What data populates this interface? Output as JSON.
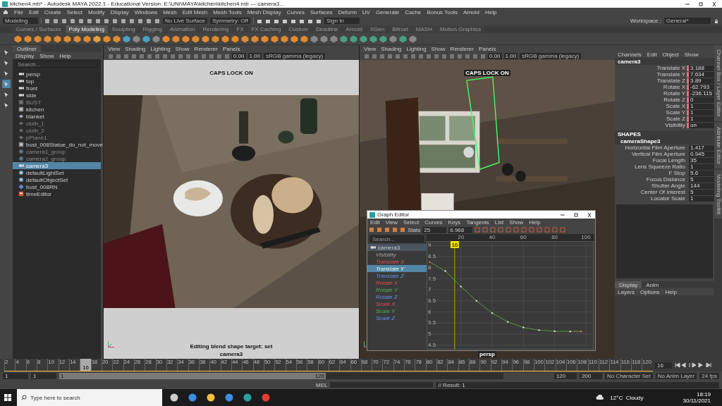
{
  "window": {
    "title": "kitchen4.mb* - Autodesk MAYA 2022.1 - Educational Version: E:\\UNI\\MAYA\\kitchen\\kitchen4.mb --- camera3..."
  },
  "menu_bar": [
    "File",
    "Edit",
    "Create",
    "Select",
    "Modify",
    "Display",
    "Windows",
    "Mesh",
    "Edit Mesh",
    "Mesh Tools",
    "Mesh Display",
    "Curves",
    "Surfaces",
    "Deform",
    "UV",
    "Generate",
    "Cache",
    "Bonus Tools",
    "Arnold",
    "Help"
  ],
  "status_line": {
    "menu_set": "Modeling",
    "live_surface": "No Live Surface",
    "symmetry": "Symmetry: Off",
    "sign_in": "Sign In",
    "workspace_label": "Workspace :",
    "workspace": "General*"
  },
  "shelf_tabs": [
    {
      "label": "Curves / Surfaces",
      "selected": false
    },
    {
      "label": "Poly Modeling",
      "selected": true
    },
    {
      "label": "Sculpting",
      "selected": false
    },
    {
      "label": "Rigging",
      "selected": false
    },
    {
      "label": "Animation",
      "selected": false
    },
    {
      "label": "Rendering",
      "selected": false
    },
    {
      "label": "FX",
      "selected": false
    },
    {
      "label": "FX Caching",
      "selected": false
    },
    {
      "label": "Custom",
      "selected": false
    },
    {
      "label": "Deadline",
      "selected": false
    },
    {
      "label": "Arnold",
      "selected": false
    },
    {
      "label": "XGen",
      "selected": false
    },
    {
      "label": "Bifrost",
      "selected": false
    },
    {
      "label": "MASH",
      "selected": false
    },
    {
      "label": "Motion Graphics",
      "selected": false
    }
  ],
  "outliner": {
    "title": "Outliner",
    "menus": [
      "Display",
      "Show",
      "Help"
    ],
    "search_placeholder": "Search...",
    "items": [
      {
        "name": "persp",
        "kind": "camera",
        "dimmed": false,
        "selected": false
      },
      {
        "name": "top",
        "kind": "camera",
        "dimmed": false,
        "selected": false
      },
      {
        "name": "front",
        "kind": "camera",
        "dimmed": false,
        "selected": false
      },
      {
        "name": "side",
        "kind": "camera",
        "dimmed": false,
        "selected": false
      },
      {
        "name": "BUST",
        "kind": "group",
        "dimmed": true,
        "selected": false
      },
      {
        "name": "kitchen",
        "kind": "group",
        "dimmed": false,
        "selected": false
      },
      {
        "name": "blanket",
        "kind": "mesh",
        "dimmed": false,
        "selected": false
      },
      {
        "name": "cloth_1",
        "kind": "mesh",
        "dimmed": true,
        "selected": false
      },
      {
        "name": "cloth_2",
        "kind": "mesh",
        "dimmed": true,
        "selected": false
      },
      {
        "name": "pPlane1",
        "kind": "mesh",
        "dimmed": true,
        "selected": false
      },
      {
        "name": "bust_008Statue_do_not_move",
        "kind": "group",
        "dimmed": false,
        "selected": false
      },
      {
        "name": "camera1_group",
        "kind": "set",
        "dimmed": true,
        "selected": false
      },
      {
        "name": "camera2_group",
        "kind": "set",
        "dimmed": true,
        "selected": false
      },
      {
        "name": "camera3",
        "kind": "camera",
        "dimmed": false,
        "selected": true
      },
      {
        "name": "defaultLightSet",
        "kind": "set",
        "dimmed": false,
        "selected": false
      },
      {
        "name": "defaultObjectSet",
        "kind": "set",
        "dimmed": false,
        "selected": false
      },
      {
        "name": "bust_008RN",
        "kind": "reference",
        "dimmed": false,
        "selected": false
      },
      {
        "name": "timeEditor",
        "kind": "editor",
        "dimmed": false,
        "selected": false
      }
    ]
  },
  "viewport_left": {
    "menus": [
      "View",
      "Shading",
      "Lighting",
      "Show",
      "Renderer",
      "Panels"
    ],
    "exposure": "0.00",
    "gamma": "1.00",
    "color_space": "sRGB gamma (legacy)",
    "caps_lock": "CAPS LOCK ON",
    "message": "Editing blend shape target: set",
    "camera": "camera3"
  },
  "viewport_right": {
    "menus": [
      "View",
      "Shading",
      "Lighting",
      "Show",
      "Renderer",
      "Panels"
    ],
    "exposure": "0.00",
    "gamma": "1.00",
    "color_space": "sRGB gamma (legacy)",
    "caps_lock": "CAPS LOCK ON",
    "camera": "persp"
  },
  "graph_editor": {
    "title": "Graph Editor",
    "menus": [
      "Edit",
      "View",
      "Select",
      "Curves",
      "Keys",
      "Tangents",
      "List",
      "Show",
      "Help"
    ],
    "stats_label": "Stats",
    "stats": "25",
    "value": "6.968",
    "search_placeholder": "Search...",
    "object": "camera3",
    "channels": [
      {
        "name": "Visibility",
        "kind": "plain",
        "selected": false
      },
      {
        "name": "Translate X",
        "kind": "x",
        "selected": false
      },
      {
        "name": "Translate Y",
        "kind": "y",
        "selected": true
      },
      {
        "name": "Translate Z",
        "kind": "z",
        "selected": false
      },
      {
        "name": "Rotate X",
        "kind": "x",
        "selected": false
      },
      {
        "name": "Rotate Y",
        "kind": "y",
        "selected": false
      },
      {
        "name": "Rotate Z",
        "kind": "z",
        "selected": false
      },
      {
        "name": "Scale X",
        "kind": "x",
        "selected": false
      },
      {
        "name": "Scale Y",
        "kind": "y",
        "selected": false
      },
      {
        "name": "Scale Z",
        "kind": "z",
        "selected": false
      }
    ],
    "chart_data": {
      "type": "line",
      "x": [
        0,
        10,
        20,
        30,
        40,
        50,
        60,
        70,
        80,
        90,
        97
      ],
      "series": [
        {
          "color": "#5a9a3c",
          "values": [
            8.25,
            7.85,
            7.15,
            6.5,
            5.95,
            5.55,
            5.3,
            5.18,
            5.13,
            5.12,
            5.12
          ]
        }
      ],
      "xlim": [
        -2,
        105
      ],
      "ylim": [
        4.3,
        9.2
      ],
      "grid": true,
      "ref_lines": [
        {
          "axis": "x",
          "value": 16,
          "label": "16",
          "color": "#b8a400"
        }
      ],
      "xticks": [
        20,
        40,
        60,
        80,
        100
      ],
      "yticks": [
        9,
        8.5,
        8,
        7.5,
        7,
        6.5,
        6,
        5.5,
        5,
        4.5
      ]
    }
  },
  "channel_box": {
    "menus": [
      "Channels",
      "Edit",
      "Object",
      "Show"
    ],
    "object": "camera3",
    "channels": [
      {
        "name": "Translate X",
        "value": "3.188",
        "keyed": true
      },
      {
        "name": "Translate Y",
        "value": "7.634",
        "keyed": true
      },
      {
        "name": "Translate Z",
        "value": "3.89",
        "keyed": true
      },
      {
        "name": "Rotate X",
        "value": "-62.793",
        "keyed": true
      },
      {
        "name": "Rotate Y",
        "value": "-236.115",
        "keyed": true
      },
      {
        "name": "Rotate Z",
        "value": "0",
        "keyed": true
      },
      {
        "name": "Scale X",
        "value": "1",
        "keyed": true
      },
      {
        "name": "Scale Y",
        "value": "1",
        "keyed": true
      },
      {
        "name": "Scale Z",
        "value": "1",
        "keyed": true
      },
      {
        "name": "Visibility",
        "value": "on",
        "keyed": true
      }
    ],
    "shapes_label": "SHAPES",
    "shape": "cameraShape3",
    "shape_channels": [
      {
        "name": "Horizontal Film Aperture",
        "value": "1.417",
        "keyed": false
      },
      {
        "name": "Vertical Film Aperture",
        "value": "0.945",
        "keyed": false
      },
      {
        "name": "Focal Length",
        "value": "35",
        "keyed": false
      },
      {
        "name": "Lens Squeeze Ratio",
        "value": "1",
        "keyed": false
      },
      {
        "name": "F Stop",
        "value": "5.6",
        "keyed": false
      },
      {
        "name": "Focus Distance",
        "value": "5",
        "keyed": false
      },
      {
        "name": "Shutter Angle",
        "value": "144",
        "keyed": false
      },
      {
        "name": "Center Of Interest",
        "value": "5",
        "keyed": false
      },
      {
        "name": "Locator Scale",
        "value": "1",
        "keyed": false
      }
    ]
  },
  "layer_editor": {
    "tabs": [
      {
        "label": "Display",
        "selected": true
      },
      {
        "label": "Anim",
        "selected": false
      }
    ],
    "menus": [
      "Layers",
      "Options",
      "Help"
    ]
  },
  "side_tabs": [
    "Channel Box / Layer Editor",
    "Attribute Editor",
    "Modeling Toolkit"
  ],
  "timeline": {
    "ticks": [
      {
        "label": "2",
        "selected": false
      },
      {
        "label": "4",
        "selected": false
      },
      {
        "label": "6",
        "selected": false
      },
      {
        "label": "8",
        "selected": false
      },
      {
        "label": "10",
        "selected": false
      },
      {
        "label": "12",
        "selected": false
      },
      {
        "label": "14",
        "selected": false
      },
      {
        "label": "16",
        "selected": true
      },
      {
        "label": "18",
        "selected": false
      },
      {
        "label": "20",
        "selected": false
      },
      {
        "label": "22",
        "selected": false
      },
      {
        "label": "24",
        "selected": false
      },
      {
        "label": "26",
        "selected": false
      },
      {
        "label": "28",
        "selected": false
      },
      {
        "label": "30",
        "selected": false
      },
      {
        "label": "32",
        "selected": false
      },
      {
        "label": "34",
        "selected": false
      },
      {
        "label": "36",
        "selected": false
      },
      {
        "label": "38",
        "selected": false
      },
      {
        "label": "40",
        "selected": false
      },
      {
        "label": "42",
        "selected": false
      },
      {
        "label": "44",
        "selected": false
      },
      {
        "label": "46",
        "selected": false
      },
      {
        "label": "48",
        "selected": false
      },
      {
        "label": "50",
        "selected": false
      },
      {
        "label": "52",
        "selected": false
      },
      {
        "label": "54",
        "selected": false
      },
      {
        "label": "56",
        "selected": false
      },
      {
        "label": "58",
        "selected": false
      },
      {
        "label": "60",
        "selected": false
      },
      {
        "label": "62",
        "selected": false
      },
      {
        "label": "64",
        "selected": false
      },
      {
        "label": "66",
        "selected": false
      },
      {
        "label": "68",
        "selected": false
      },
      {
        "label": "70",
        "selected": false
      },
      {
        "label": "72",
        "selected": false
      },
      {
        "label": "74",
        "selected": false
      },
      {
        "label": "76",
        "selected": false
      },
      {
        "label": "78",
        "selected": false
      },
      {
        "label": "80",
        "selected": false
      },
      {
        "label": "82",
        "selected": false
      },
      {
        "label": "84",
        "selected": false
      },
      {
        "label": "86",
        "selected": false
      },
      {
        "label": "88",
        "selected": false
      },
      {
        "label": "90",
        "selected": false
      },
      {
        "label": "92",
        "selected": false
      },
      {
        "label": "94",
        "selected": false
      },
      {
        "label": "96",
        "selected": false
      },
      {
        "label": "98",
        "selected": false
      },
      {
        "label": "100",
        "selected": false
      },
      {
        "label": "102",
        "selected": false
      },
      {
        "label": "104",
        "selected": false
      },
      {
        "label": "106",
        "selected": false
      },
      {
        "label": "108",
        "selected": false
      },
      {
        "label": "110",
        "selected": false
      },
      {
        "label": "112",
        "selected": false
      },
      {
        "label": "114",
        "selected": false
      },
      {
        "label": "116",
        "selected": false
      },
      {
        "label": "118",
        "selected": false
      },
      {
        "label": "120",
        "selected": false
      }
    ],
    "current_field": "16"
  },
  "range": {
    "start": "1",
    "playback_start": "1",
    "slider_start": "1",
    "slider_end": "120",
    "level": 0.6,
    "playback_end": "120",
    "end": "200",
    "character_set": "No Character Set",
    "anim_layer": "No Anim Layer",
    "fps": "24 fps"
  },
  "command_line": {
    "language": "MEL",
    "result": "// Result: 1"
  },
  "taskbar": {
    "search_placeholder": "Type here to search",
    "weather": "12°C  Cloudy",
    "time": "18:19",
    "date": "30/11/2021"
  }
}
